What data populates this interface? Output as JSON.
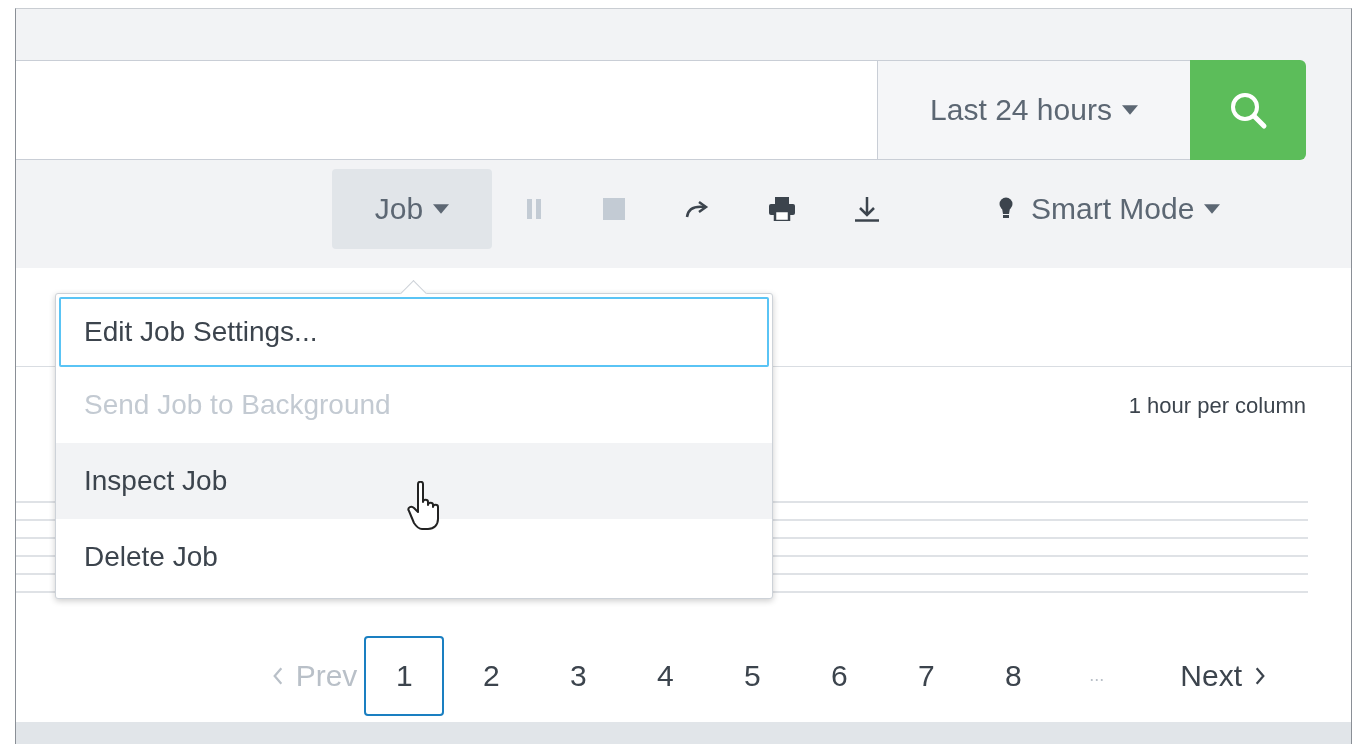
{
  "time_range": {
    "label": "Last 24 hours"
  },
  "toolbar": {
    "job_button": {
      "label": "Job",
      "expanded": true
    },
    "actions": [
      {
        "kind": "pause",
        "disabled": true
      },
      {
        "kind": "stop",
        "disabled": true
      },
      {
        "kind": "share",
        "disabled": false
      },
      {
        "kind": "print",
        "disabled": false
      },
      {
        "kind": "export",
        "disabled": false
      }
    ],
    "mode": {
      "label": "Smart Mode"
    }
  },
  "job_menu": [
    {
      "label": "Edit Job Settings...",
      "focused": true,
      "hovered": false,
      "disabled": false
    },
    {
      "label": "Send Job to Background",
      "focused": false,
      "hovered": false,
      "disabled": true
    },
    {
      "label": "Inspect Job",
      "focused": false,
      "hovered": true,
      "disabled": false
    },
    {
      "label": "Delete Job",
      "focused": false,
      "hovered": false,
      "disabled": false
    }
  ],
  "timeline": {
    "scale_label": "1 hour per column"
  },
  "pagination": {
    "prev": {
      "label": "Prev",
      "disabled": true
    },
    "pages": [
      {
        "label": "1",
        "selected": true
      },
      {
        "label": "2",
        "selected": false
      },
      {
        "label": "3",
        "selected": false
      },
      {
        "label": "4",
        "selected": false
      },
      {
        "label": "5",
        "selected": false
      },
      {
        "label": "6",
        "selected": false
      },
      {
        "label": "7",
        "selected": false
      },
      {
        "label": "8",
        "selected": false
      }
    ],
    "ellipsis": "...",
    "next": {
      "label": "Next",
      "disabled": false
    }
  }
}
